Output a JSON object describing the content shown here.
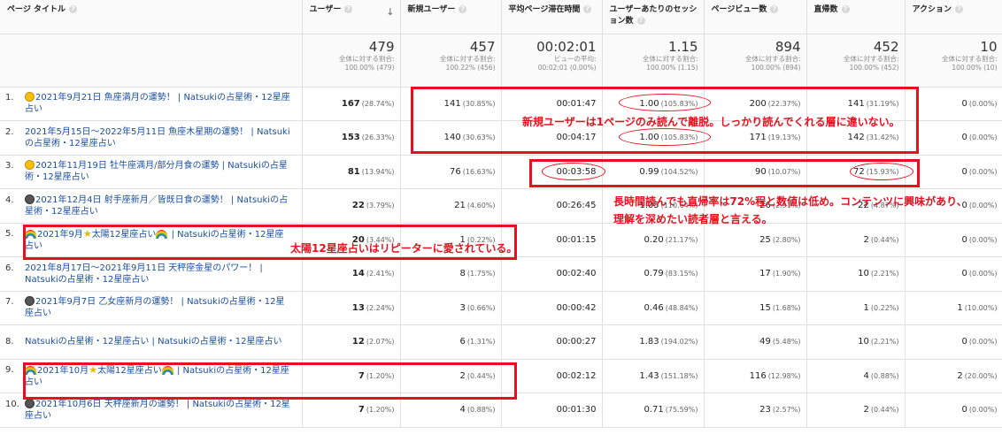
{
  "columns": [
    {
      "label": "ページ タイトル"
    },
    {
      "label": "ユーザー"
    },
    {
      "label": "新規ユーザー"
    },
    {
      "label": "平均ページ滞在時間"
    },
    {
      "label": "ユーザーあたりのセッション数"
    },
    {
      "label": "ページビュー数"
    },
    {
      "label": "直帰数"
    },
    {
      "label": "アクション"
    }
  ],
  "totals": [
    {
      "value": "479",
      "line1": "全体に対する割合:",
      "line2": "100.00% (479)"
    },
    {
      "value": "457",
      "line1": "全体に対する割合:",
      "line2": "100.22% (456)"
    },
    {
      "value": "00:02:01",
      "line1": "ビューの平均:",
      "line2": "00:02:01 (0.00%)"
    },
    {
      "value": "1.15",
      "line1": "全体に対する割合:",
      "line2": "100.00% (1.15)"
    },
    {
      "value": "894",
      "line1": "全体に対する割合:",
      "line2": "100.00% (894)"
    },
    {
      "value": "452",
      "line1": "全体に対する割合:",
      "line2": "100.00% (452)"
    },
    {
      "value": "10",
      "line1": "全体に対する割合:",
      "line2": "100.00% (10)"
    }
  ],
  "rows": [
    {
      "idx": "1.",
      "emoji": "sun",
      "star": false,
      "title": "2021年9月21日 魚座満月の運勢！ | Natsukiの占星術・12星座占い",
      "users": "167",
      "users_pct": "(28.74%)",
      "new_users": "141",
      "new_pct": "(30.85%)",
      "avg_time": "00:01:47",
      "spu": "1.00",
      "spu_pct": "(105.83%)",
      "pv": "200",
      "pv_pct": "(22.37%)",
      "bounces": "141",
      "b_pct": "(31.19%)",
      "actions": "0",
      "a_pct": "(0.00%)"
    },
    {
      "idx": "2.",
      "emoji": "",
      "star": false,
      "title": "2021年5月15日～2022年5月11日 魚座木星期の運勢！ | Natsukiの占星術・12星座占い",
      "users": "153",
      "users_pct": "(26.33%)",
      "new_users": "140",
      "new_pct": "(30.63%)",
      "avg_time": "00:04:17",
      "spu": "1.00",
      "spu_pct": "(105.83%)",
      "pv": "171",
      "pv_pct": "(19.13%)",
      "bounces": "142",
      "b_pct": "(31.42%)",
      "actions": "0",
      "a_pct": "(0.00%)"
    },
    {
      "idx": "3.",
      "emoji": "sun",
      "star": false,
      "title": "2021年11月19日 牡牛座満月/部分月食の運勢 | Natsukiの占星術・12星座占い",
      "users": "81",
      "users_pct": "(13.94%)",
      "new_users": "76",
      "new_pct": "(16.63%)",
      "avg_time": "00:03:58",
      "spu": "0.99",
      "spu_pct": "(104.52%)",
      "pv": "90",
      "pv_pct": "(10.07%)",
      "bounces": "72",
      "b_pct": "(15.93%)",
      "actions": "0",
      "a_pct": "(0.00%)"
    },
    {
      "idx": "4.",
      "emoji": "moon",
      "star": false,
      "title": "2021年12月4日 射手座新月／皆既日食の運勢！ | Natsukiの占星術・12星座占い",
      "users": "22",
      "users_pct": "(3.79%)",
      "new_users": "21",
      "new_pct": "(4.60%)",
      "avg_time": "00:26:45",
      "spu": "1.05",
      "spu_pct": "(110.64%)",
      "pv": "26",
      "pv_pct": "(2.91%)",
      "bounces": "22",
      "b_pct": "(4.87%)",
      "actions": "0",
      "a_pct": "(0.00%)"
    },
    {
      "idx": "5.",
      "emoji": "rainbow",
      "star": true,
      "title_a": "2021年9月",
      "title_b": "太陽12星座占い",
      "title_c": " | Natsukiの占星術・12星座占い",
      "users": "20",
      "users_pct": "(3.44%)",
      "new_users": "1",
      "new_pct": "(0.22%)",
      "avg_time": "00:01:15",
      "spu": "0.20",
      "spu_pct": "(21.17%)",
      "pv": "25",
      "pv_pct": "(2.80%)",
      "bounces": "2",
      "b_pct": "(0.44%)",
      "actions": "0",
      "a_pct": "(0.00%)"
    },
    {
      "idx": "6.",
      "emoji": "",
      "star": false,
      "title": "2021年8月17日～2021年9月11日 天秤座金星のパワー！ | Natsukiの占星術・12星座占い",
      "users": "14",
      "users_pct": "(2.41%)",
      "new_users": "8",
      "new_pct": "(1.75%)",
      "avg_time": "00:02:40",
      "spu": "0.79",
      "spu_pct": "(83.15%)",
      "pv": "17",
      "pv_pct": "(1.90%)",
      "bounces": "10",
      "b_pct": "(2.21%)",
      "actions": "0",
      "a_pct": "(0.00%)"
    },
    {
      "idx": "7.",
      "emoji": "moon",
      "star": false,
      "title": "2021年9月7日 乙女座新月の運勢！ | Natsukiの占星術・12星座占い",
      "users": "13",
      "users_pct": "(2.24%)",
      "new_users": "3",
      "new_pct": "(0.66%)",
      "avg_time": "00:00:42",
      "spu": "0.46",
      "spu_pct": "(48.84%)",
      "pv": "15",
      "pv_pct": "(1.68%)",
      "bounces": "1",
      "b_pct": "(0.22%)",
      "actions": "1",
      "a_pct": "(10.00%)"
    },
    {
      "idx": "8.",
      "emoji": "",
      "star": false,
      "title": "Natsukiの占星術・12星座占い | Natsukiの占星術・12星座占い",
      "users": "12",
      "users_pct": "(2.07%)",
      "new_users": "6",
      "new_pct": "(1.31%)",
      "avg_time": "00:00:27",
      "spu": "1.83",
      "spu_pct": "(194.02%)",
      "pv": "49",
      "pv_pct": "(5.48%)",
      "bounces": "10",
      "b_pct": "(2.21%)",
      "actions": "0",
      "a_pct": "(0.00%)"
    },
    {
      "idx": "9.",
      "emoji": "rainbow",
      "star": true,
      "title_a": "2021年10月",
      "title_b": "太陽12星座占い",
      "title_c": " | Natsukiの占星術・12星座占い",
      "users": "7",
      "users_pct": "(1.20%)",
      "new_users": "2",
      "new_pct": "(0.44%)",
      "avg_time": "00:02:12",
      "spu": "1.43",
      "spu_pct": "(151.18%)",
      "pv": "116",
      "pv_pct": "(12.98%)",
      "bounces": "4",
      "b_pct": "(0.88%)",
      "actions": "2",
      "a_pct": "(20.00%)"
    },
    {
      "idx": "10.",
      "emoji": "moon",
      "star": false,
      "title": "2021年10月6日 天秤座新月の運勢！ | Natsukiの占星術・12星座占い",
      "users": "7",
      "users_pct": "(1.20%)",
      "new_users": "4",
      "new_pct": "(0.88%)",
      "avg_time": "00:01:30",
      "spu": "0.71",
      "spu_pct": "(75.59%)",
      "pv": "23",
      "pv_pct": "(2.57%)",
      "bounces": "2",
      "b_pct": "(0.44%)",
      "actions": "0",
      "a_pct": "(0.00%)"
    }
  ],
  "annotations": {
    "note1": "新規ユーザーは1ページのみ読んで離脱。しっかり読んでくれる層に違いない。",
    "note2_line1": "長時間読んでも直帰率は72%程と数値は低め。コンテンツに興味があり、",
    "note2_line2": "理解を深めたい読者層と言える。",
    "note3": "太陽12星座占いはリピーターに愛されている。"
  },
  "colors": {
    "link": "#1a4fa0",
    "annotation": "#e8101e",
    "header_bg": "#fafafa"
  }
}
